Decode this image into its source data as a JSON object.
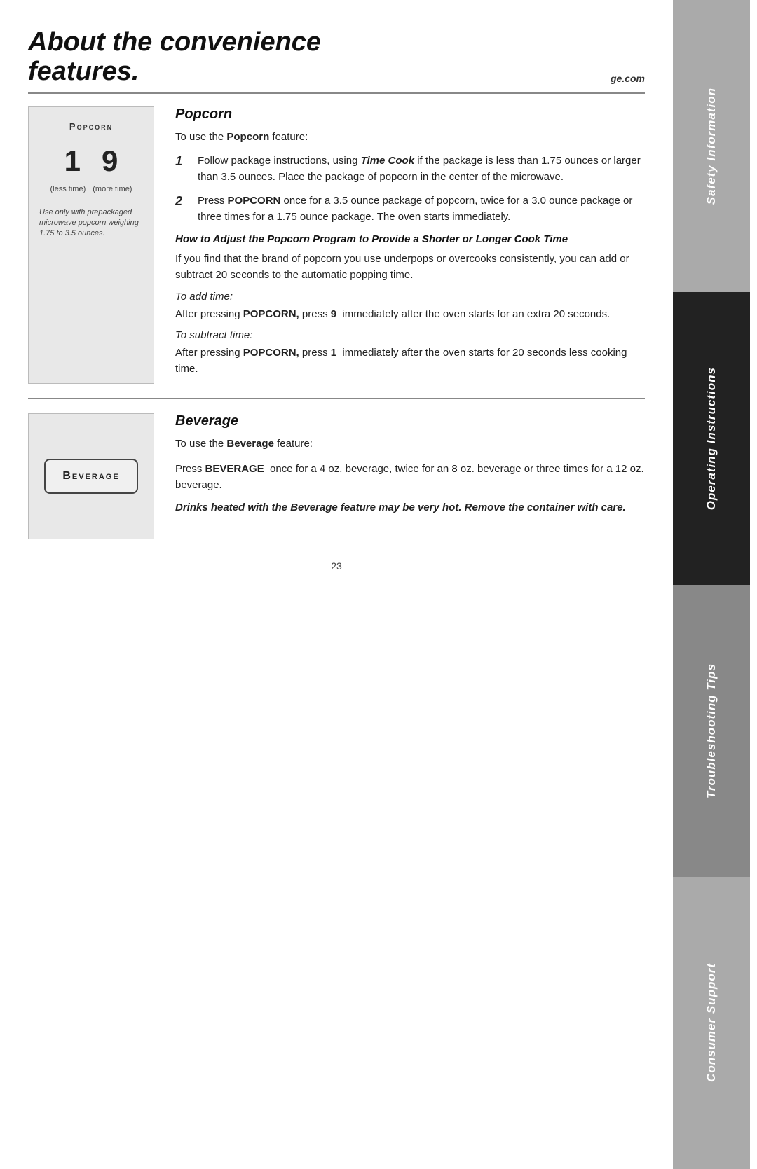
{
  "header": {
    "title_line1": "About the convenience",
    "title_line2": "features.",
    "website": "ge.com"
  },
  "sidebar": {
    "safety_label": "Safety Information",
    "operating_label": "Operating Instructions",
    "troubleshooting_label": "Troubleshooting Tips",
    "consumer_label": "Consumer Support"
  },
  "popcorn": {
    "section_heading": "Popcorn",
    "image_label": "Popcorn",
    "number_1": "1",
    "number_9": "9",
    "sublabel_less": "(less time)",
    "sublabel_more": "(more time)",
    "img_caption": "Use only with prepackaged microwave popcorn weighing 1.75 to 3.5 ounces.",
    "intro": "To use the Popcorn feature:",
    "step1_text": "Follow package instructions, using Time Cook if the package is less than 1.75 ounces or larger than 3.5 ounces. Place the package of popcorn in the center of the microwave.",
    "step2_text": "Press POPCORN once for a 3.5 ounce package of popcorn, twice for a 3.0 ounce package or three times for a 1.75 ounce package. The oven starts immediately.",
    "adjust_heading": "How to Adjust the Popcorn Program to Provide a Shorter or Longer Cook Time",
    "adjust_body": "If you find that the brand of popcorn you use underpops or overcooks consistently, you can add or subtract 20 seconds to the automatic popping time.",
    "to_add_label": "To add time:",
    "to_add_body": "After pressing POPCORN, press 9  immediately after the oven starts for an extra 20 seconds.",
    "to_subtract_label": "To subtract time:",
    "to_subtract_body": "After pressing POPCORN, press 1  immediately after the oven starts for 20 seconds less cooking time."
  },
  "beverage": {
    "section_heading": "Beverage",
    "button_label": "Beverage",
    "intro": "To use the Beverage feature:",
    "body": "Press BEVERAGE  once for a 4 oz. beverage, twice for an 8 oz. beverage or three times for a 12 oz. beverage.",
    "warning": "Drinks heated with the Beverage feature may be very hot. Remove the container with care."
  },
  "page_number": "23"
}
